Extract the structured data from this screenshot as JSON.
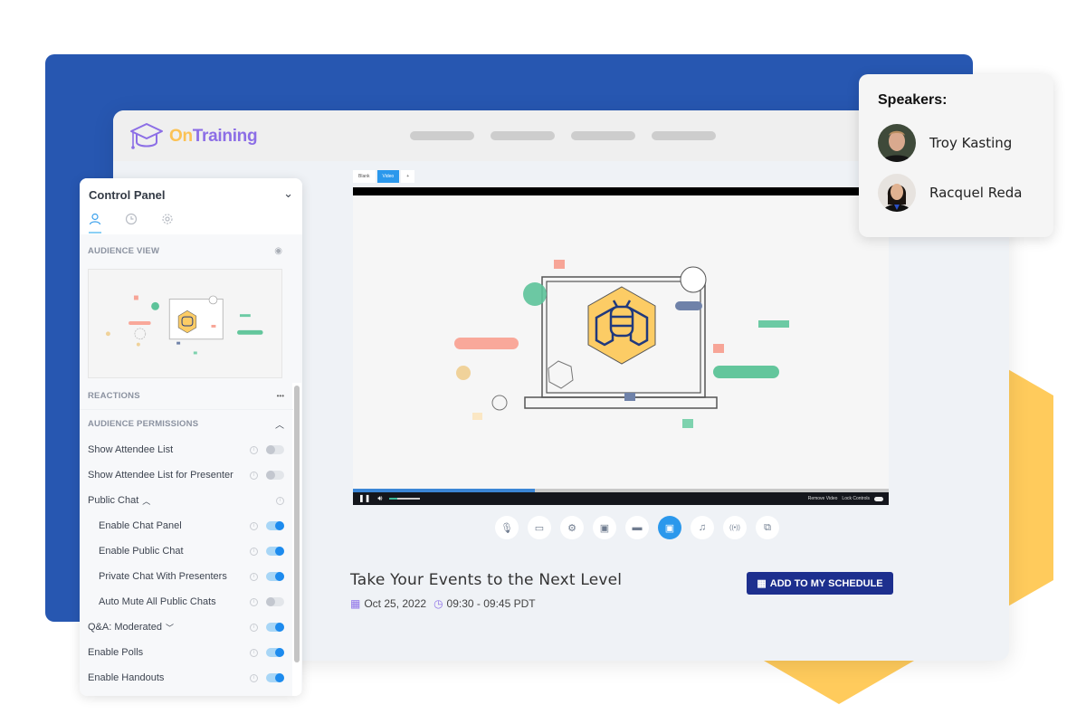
{
  "brand": {
    "logo_on": "On",
    "logo_training": "Training",
    "colors": {
      "background_card": "#2757b1",
      "hexagon": "#ffcb5c",
      "accent_blue": "#2b98ec",
      "button_navy": "#1d2f8e",
      "logo_purple": "#8c6ee6",
      "logo_yellow": "#fbc255"
    }
  },
  "header": {
    "nav_placeholders": 4
  },
  "stage": {
    "scene_tabs": [
      {
        "label": "Blank",
        "active": false
      },
      {
        "label": "Video",
        "active": true
      },
      {
        "label": "+",
        "active": false
      }
    ],
    "video": {
      "progress_fraction": 0.34,
      "volume_fraction": 0.25,
      "play_state_icon": "pause-icon",
      "remove_video_label": "Remove Video",
      "lock_controls_label": "Lock Controls"
    },
    "tools": [
      {
        "icon": "microphone-icon",
        "glyph": "🎙",
        "active": false
      },
      {
        "icon": "camera-icon",
        "glyph": "▭",
        "active": false
      },
      {
        "icon": "settings-icon",
        "glyph": "⚙",
        "active": false
      },
      {
        "icon": "screen-share-icon",
        "glyph": "▣",
        "active": false
      },
      {
        "icon": "slides-icon",
        "glyph": "▬",
        "active": false
      },
      {
        "icon": "video-icon",
        "glyph": "▣",
        "active": true
      },
      {
        "icon": "music-icon",
        "glyph": "♫",
        "active": false
      },
      {
        "icon": "broadcast-icon",
        "glyph": "((•))",
        "active": false
      },
      {
        "icon": "whiteboard-icon",
        "glyph": "⧉",
        "active": false
      }
    ]
  },
  "event": {
    "title": "Take Your Events to the Next Level",
    "date": "Oct 25, 2022",
    "time": "09:30 - 09:45 PDT",
    "add_schedule_label": "ADD TO MY SCHEDULE"
  },
  "control_panel": {
    "title": "Control Panel",
    "tabs": [
      {
        "icon": "user-icon",
        "glyph": "⍝",
        "active": true
      },
      {
        "icon": "clock-icon",
        "glyph": "◷",
        "active": false
      },
      {
        "icon": "gear-icon",
        "glyph": "⚙",
        "active": false
      }
    ],
    "audience_view_label": "AUDIENCE VIEW",
    "reactions_label": "REACTIONS",
    "reactions_more": "•••",
    "permissions_label": "AUDIENCE PERMISSIONS",
    "permissions": [
      {
        "label": "Show Attendee List",
        "sub": false,
        "toggle": "off"
      },
      {
        "label": "Show Attendee List for Presenter",
        "sub": false,
        "toggle": "off"
      },
      {
        "label": "Public Chat",
        "sub": false,
        "toggle": "none",
        "caret": "^"
      },
      {
        "label": "Enable Chat Panel",
        "sub": true,
        "toggle": "on"
      },
      {
        "label": "Enable Public Chat",
        "sub": true,
        "toggle": "on"
      },
      {
        "label": "Private Chat With Presenters",
        "sub": true,
        "toggle": "on"
      },
      {
        "label": "Auto Mute All Public Chats",
        "sub": true,
        "toggle": "off"
      },
      {
        "label": "Q&A: Moderated",
        "sub": false,
        "toggle": "on",
        "caret": "v"
      },
      {
        "label": "Enable Polls",
        "sub": false,
        "toggle": "on"
      },
      {
        "label": "Enable Handouts",
        "sub": false,
        "toggle": "on"
      }
    ]
  },
  "speakers": {
    "title": "Speakers:",
    "list": [
      {
        "name": "Troy Kasting"
      },
      {
        "name": "Racquel Reda"
      }
    ]
  }
}
